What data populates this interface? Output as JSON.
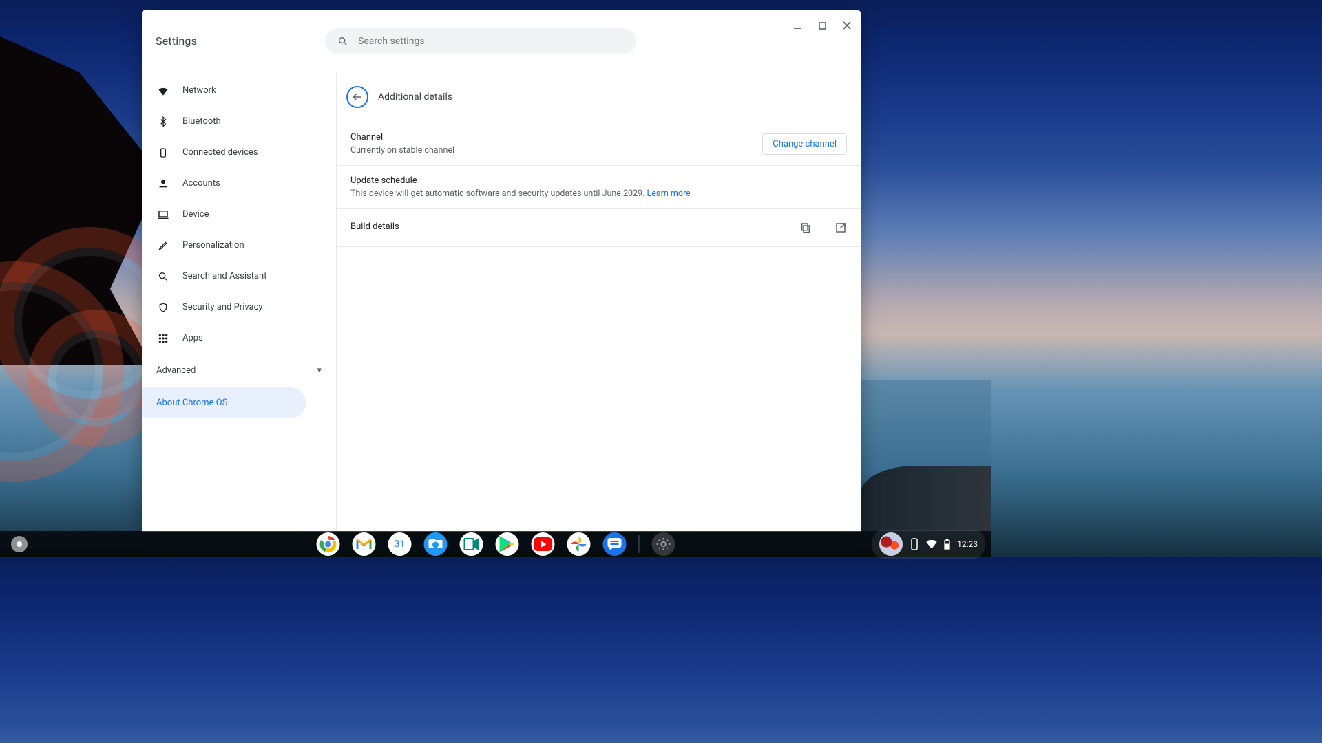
{
  "app_title": "Settings",
  "search": {
    "placeholder": "Search settings"
  },
  "sidebar": {
    "items": [
      {
        "label": "Network"
      },
      {
        "label": "Bluetooth"
      },
      {
        "label": "Connected devices"
      },
      {
        "label": "Accounts"
      },
      {
        "label": "Device"
      },
      {
        "label": "Personalization"
      },
      {
        "label": "Search and Assistant"
      },
      {
        "label": "Security and Privacy"
      },
      {
        "label": "Apps"
      }
    ],
    "advanced_label": "Advanced",
    "about_label": "About Chrome OS"
  },
  "main": {
    "page_title": "Additional details",
    "channel": {
      "title": "Channel",
      "subtitle": "Currently on stable channel",
      "button": "Change channel"
    },
    "update": {
      "title": "Update schedule",
      "subtitle": "This device will get automatic software and security updates until June 2029. ",
      "learn_more": "Learn more"
    },
    "build": {
      "title": "Build details"
    }
  },
  "shelf": {
    "time": "12:23"
  }
}
